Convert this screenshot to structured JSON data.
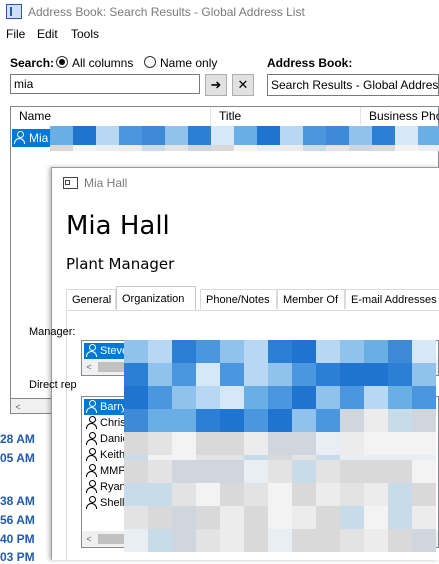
{
  "address_book": {
    "title": "Address Book: Search Results - Global Address List",
    "menu": [
      "File",
      "Edit",
      "Tools"
    ],
    "search_label": "Search:",
    "radio_all": "All columns",
    "radio_name": "Name only",
    "search_value": "mia",
    "go_icon": "arrow-right-icon",
    "clear_icon": "close-icon",
    "address_book_label": "Address Book:",
    "address_book_value": "Search Results - Global Address List",
    "columns": [
      "Name",
      "Title",
      "Business Phone"
    ],
    "result_name": "Mia",
    "scroll_left": "<",
    "scroll_right": ">"
  },
  "calendar_times": [
    "28 AM",
    "05 AM",
    "38 AM",
    "56 AM",
    "40 PM",
    "03 PM"
  ],
  "contact_card": {
    "window_title": "Mia Hall",
    "name": "Mia Hall",
    "job_title": "Plant Manager",
    "tabs": [
      "General",
      "Organization",
      "Phone/Notes",
      "Member Of",
      "E-mail Addresses"
    ],
    "manager_label": "Manager:",
    "manager": "Steve",
    "directs_label": "Direct rep",
    "directs": [
      "Barry",
      "Chris A",
      "Danie",
      "Keith",
      "MMPT",
      "Ryan S",
      "Shelly"
    ],
    "scroll_left": "<",
    "scroll_right": ">"
  },
  "colors": {
    "selection": "#0078d7",
    "time_text": "#1f5bb0"
  }
}
